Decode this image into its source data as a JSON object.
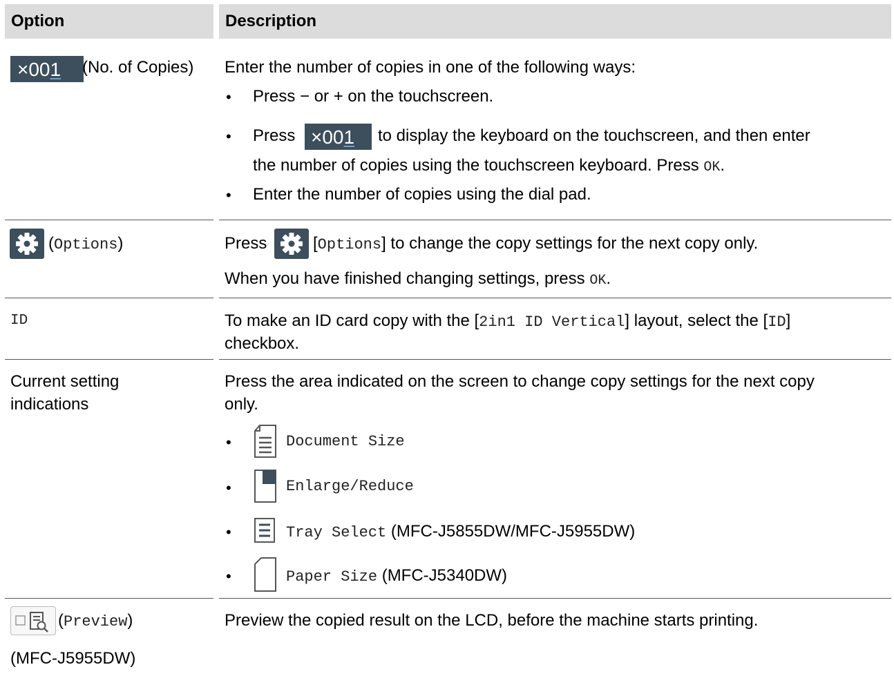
{
  "header": {
    "option": "Option",
    "description": "Description"
  },
  "rows": {
    "copies": {
      "button_x": "×",
      "button_digits": "00",
      "button_last_digit": "1",
      "option_label": "(No. of Copies)",
      "intro": "Enter the number of copies in one of the following ways:",
      "b1_a": "Press ",
      "b1_minus": "−",
      "b1_b": " or ",
      "b1_plus": "+",
      "b1_c": " on the touchscreen.",
      "b2_press": "Press",
      "b2_rest": "to display the keyboard on the touchscreen, and then enter",
      "b2_line2": "the number of copies using the touchscreen keyboard. Press ",
      "b2_ok": "OK",
      "b2_end": ".",
      "b3": "Enter the number of copies using the dial pad."
    },
    "options": {
      "option_label_open": "(",
      "option_label": "Options",
      "option_label_close": ")",
      "press": "Press",
      "bracket_open": "[",
      "options_word": "Options",
      "bracket_close": "]",
      "rest": " to change the copy settings for the next copy only.",
      "line2": "When you have finished changing settings, press ",
      "ok": "OK",
      "end": "."
    },
    "id": {
      "option_label": "ID",
      "d1": "To make an ID card copy with the [",
      "d2": "2in1 ID Vertical",
      "d3": "] layout, select the [",
      "d4": "ID",
      "d5": "]",
      "line2": "checkbox."
    },
    "current": {
      "option_line1": "Current setting",
      "option_line2": "indications",
      "desc_line1": "Press the area indicated on the screen to change copy settings for the next copy",
      "desc_line2": "only.",
      "items": [
        {
          "label": "Document Size",
          "note": ""
        },
        {
          "label": "Enlarge/Reduce",
          "note": ""
        },
        {
          "label": "Tray Select",
          "note": " (MFC-J5855DW/MFC-J5955DW)"
        },
        {
          "label": "Paper Size",
          "note": " (MFC-J5340DW)"
        }
      ]
    },
    "preview": {
      "option_label_open": "(",
      "option_label": "Preview",
      "option_label_close": ")",
      "model": "(MFC-J5955DW)",
      "desc": "Preview the copied result on the LCD, before the machine starts printing."
    }
  },
  "colors": {
    "header_bg": "#dcdcdc",
    "button_bg": "#3d4e5c",
    "rule": "#555555"
  }
}
